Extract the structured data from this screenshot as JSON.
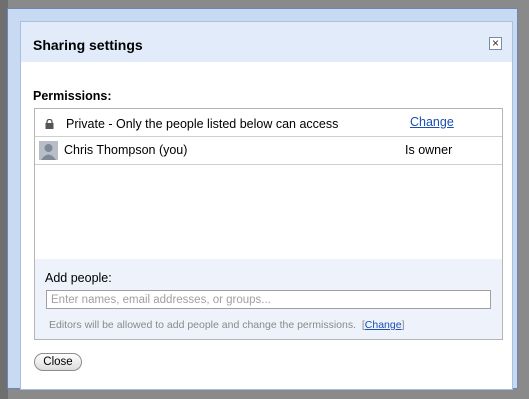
{
  "dialog": {
    "title": "Sharing settings",
    "close_icon": "close-x-icon"
  },
  "permissions": {
    "heading": "Permissions:",
    "visibility": {
      "icon": "lock-icon",
      "text": "Private - Only the people listed below can access",
      "change_label": "Change"
    },
    "people": [
      {
        "name": "Chris Thompson (you)",
        "role": "Is owner",
        "icon": "avatar-icon"
      }
    ]
  },
  "add_people": {
    "label": "Add people:",
    "placeholder": "Enter names, email addresses, or groups...",
    "value": "",
    "note": "Editors will be allowed to add people and change the permissions.",
    "note_open": "[",
    "note_change_label": "Change",
    "note_close": "]"
  },
  "footer": {
    "close_label": "Close"
  },
  "colors": {
    "header_bg": "#e1ebf9",
    "link": "#1a4fb3",
    "add_section_bg": "#edf2fb"
  }
}
